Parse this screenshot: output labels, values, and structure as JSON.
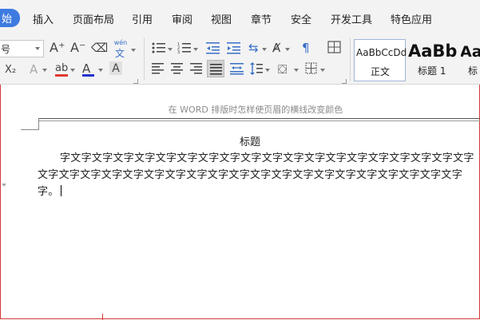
{
  "menu": {
    "active_tab": "始",
    "tabs": [
      "插入",
      "页面布局",
      "引用",
      "审阅",
      "视图",
      "章节",
      "安全",
      "开发工具",
      "特色应用"
    ]
  },
  "ribbon": {
    "font_size_value": "号",
    "grow_font": "A⁺",
    "shrink_font": "A⁻",
    "clear_format": "⌫",
    "pinyin_top": "wén",
    "pinyin_bottom": "文",
    "subscript": "X₂",
    "text_effect": "A",
    "highlight": "ab",
    "font_color": "A",
    "char_shading": "A",
    "styles": [
      {
        "preview": "AaBbCcDd",
        "label": "正文"
      },
      {
        "preview": "AaBb",
        "label": "标题 1"
      },
      {
        "preview": "Aa",
        "label": "标"
      }
    ],
    "highlight_color": "#e03a2f",
    "font_color_color": "#2233cc"
  },
  "document": {
    "header_note": "在 WORD 排版时怎样使页眉的横线改变颜色",
    "title": "标题",
    "lines": [
      "字文字文字文字文字文字文字文字文字文字文字文字文字文字文字文字文字文字文字文字",
      "文字文字文字文字文字文字文字文字文字文字文字文字文字文字文字文字文字文字文字文字",
      "字。"
    ]
  },
  "colors": {
    "menu_bg": "#f3f3f3",
    "accent": "#3d7be0",
    "frame": "#d43a3a"
  }
}
